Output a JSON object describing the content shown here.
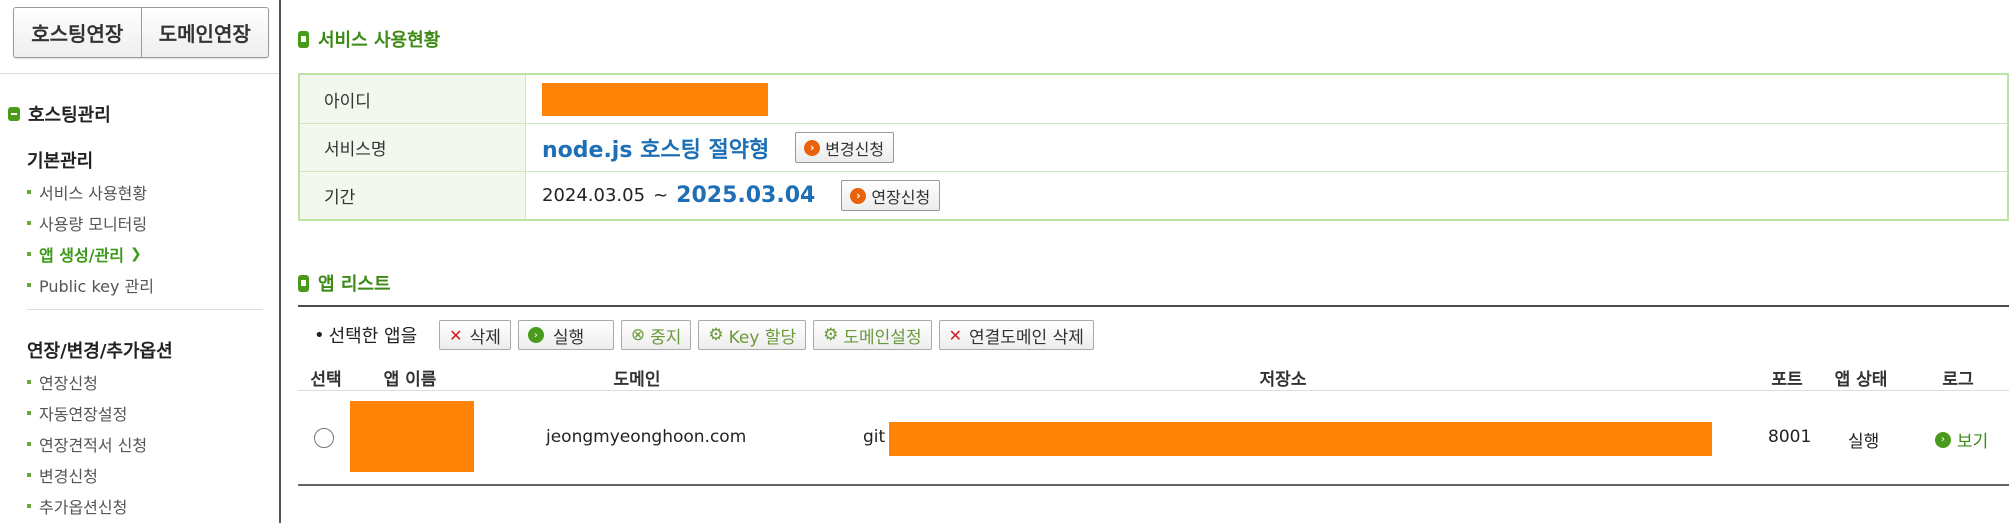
{
  "sidebar": {
    "tabs": [
      "호스팅연장",
      "도메인연장"
    ],
    "section_title": "호스팅관리",
    "groups": [
      {
        "title": "기본관리",
        "items": [
          "서비스 사용현황",
          "사용량 모니터링",
          "앱 생성/관리",
          "Public key 관리"
        ],
        "active": "앱 생성/관리"
      },
      {
        "title": "연장/변경/추가옵션",
        "items": [
          "연장신청",
          "자동연장설정",
          "연장견적서 신청",
          "변경신청",
          "추가옵션신청"
        ]
      }
    ]
  },
  "usage": {
    "title": "서비스 사용현황",
    "rows": {
      "id": {
        "label": "아이디"
      },
      "service": {
        "label": "서비스명",
        "value": "node.js 호스팅 절약형",
        "button": "변경신청"
      },
      "period": {
        "label": "기간",
        "start": "2024.03.05",
        "separator": "~",
        "end": "2025.03.04",
        "button": "연장신청"
      }
    }
  },
  "apps": {
    "title": "앱 리스트",
    "selected_label": "선택한 앱을",
    "actions": [
      "삭제",
      "실행",
      "중지",
      "Key 할당",
      "도메인설정",
      "연결도메인 삭제"
    ],
    "columns": [
      "선택",
      "앱 이름",
      "도메인",
      "저장소",
      "포트",
      "앱 상태",
      "로그"
    ],
    "rows": [
      {
        "domain": "jeongmyeonghoon.com",
        "repo_prefix": "git",
        "port": "8001",
        "status": "실행",
        "log": "보기"
      }
    ]
  },
  "colors": {
    "accent_green": "#3c8a14",
    "link_blue": "#1e6fb5",
    "redaction_orange": "#ff8306"
  }
}
